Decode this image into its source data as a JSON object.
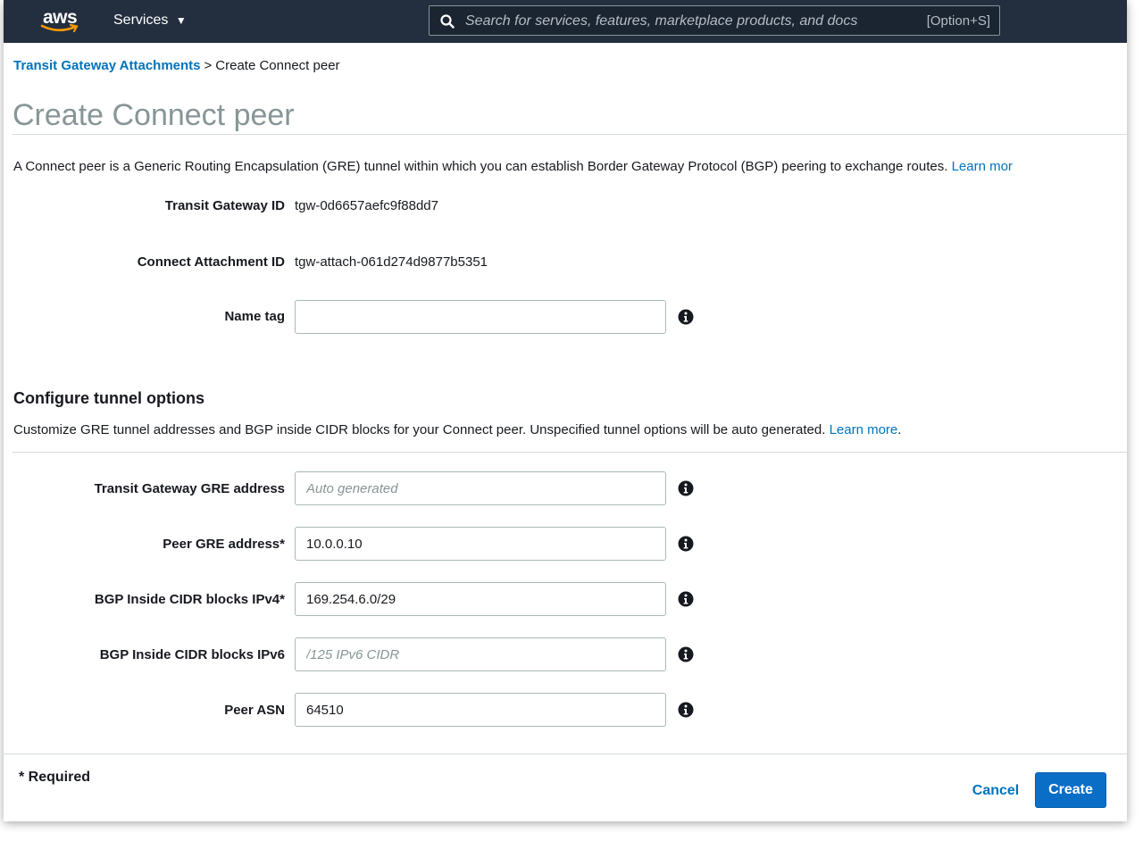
{
  "topnav": {
    "logo_text": "aws",
    "services_label": "Services",
    "search_placeholder": "Search for services, features, marketplace products, and docs",
    "search_shortcut": "[Option+S]"
  },
  "breadcrumb": {
    "parent": "Transit Gateway Attachments",
    "separator": ">",
    "current": "Create Connect peer"
  },
  "page": {
    "title": "Create Connect peer",
    "intro": "A Connect peer is a Generic Routing Encapsulation (GRE) tunnel within which you can establish Border Gateway Protocol (BGP) peering to exchange routes.",
    "intro_link": "Learn mor"
  },
  "fields": {
    "transit_gateway_id": {
      "label": "Transit Gateway ID",
      "value": "tgw-0d6657aefc9f88dd7"
    },
    "connect_attachment_id": {
      "label": "Connect Attachment ID",
      "value": "tgw-attach-061d274d9877b5351"
    },
    "name_tag": {
      "label": "Name tag",
      "value": ""
    }
  },
  "tunnel": {
    "title": "Configure tunnel options",
    "description": "Customize GRE tunnel addresses and BGP inside CIDR blocks for your Connect peer. Unspecified tunnel options will be auto generated.",
    "learn_more": "Learn more",
    "period": ".",
    "tgw_gre": {
      "label": "Transit Gateway GRE address",
      "value": "",
      "placeholder": "Auto generated"
    },
    "peer_gre": {
      "label": "Peer GRE address*",
      "value": "10.0.0.10"
    },
    "bgp_ipv4": {
      "label": "BGP Inside CIDR blocks IPv4*",
      "value": "169.254.6.0/29"
    },
    "bgp_ipv6": {
      "label": "BGP Inside CIDR blocks IPv6",
      "value": "",
      "placeholder": "/125 IPv6 CIDR"
    },
    "peer_asn": {
      "label": "Peer ASN",
      "value": "64510"
    }
  },
  "footer": {
    "required_note": "* Required",
    "cancel_label": "Cancel",
    "create_label": "Create"
  },
  "colors": {
    "nav_bg": "#232f3e",
    "link": "#0073bb",
    "primary_button": "#0a6ec7",
    "aws_orange": "#ff9900"
  },
  "icons": [
    "search-icon",
    "info-icon",
    "caret-down-icon",
    "aws-smile-icon"
  ]
}
